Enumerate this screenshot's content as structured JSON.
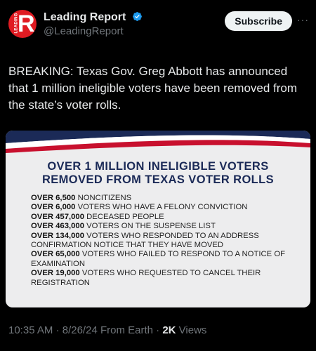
{
  "header": {
    "account_name": "Leading Report",
    "handle": "@LeadingReport",
    "avatar_letter": "R",
    "avatar_side_text": "LEADING",
    "subscribe_label": "Subscribe",
    "more_label": "···",
    "verified_icon": "verified-badge-icon",
    "brand_color": "#e01b22"
  },
  "tweet": {
    "text": "BREAKING: Texas Gov. Greg Abbott has announced that 1 million ineligible voters have been removed from the state’s voter rolls."
  },
  "card": {
    "title_line1": "OVER 1 MILLION INELIGIBLE VOTERS",
    "title_line2": "REMOVED FROM TEXAS VOTER ROLLS",
    "items": [
      {
        "amount": "OVER 6,500",
        "desc": " NONCITIZENS"
      },
      {
        "amount": "OVER 6,000",
        "desc": " VOTERS WHO HAVE A FELONY CONVICTION"
      },
      {
        "amount": "OVER 457,000",
        "desc": " DECEASED PEOPLE"
      },
      {
        "amount": "OVER 463,000",
        "desc": " VOTERS ON THE SUSPENSE LIST"
      },
      {
        "amount": "OVER 134,000",
        "desc": " VOTERS WHO RESPONDED TO AN ADDRESS CONFIRMATION NOTICE THAT THEY HAVE MOVED"
      },
      {
        "amount": "OVER 65,000",
        "desc": " VOTERS WHO FAILED TO RESPOND TO A NOTICE OF EXAMINATION"
      },
      {
        "amount": "OVER 19,000",
        "desc": " VOTERS WHO REQUESTED TO CANCEL THEIR REGISTRATION"
      }
    ],
    "colors": {
      "navy": "#1b2a57",
      "red": "#c8102e",
      "background": "#ededee"
    }
  },
  "footer": {
    "time": "10:35 AM",
    "date": "8/26/24",
    "source": "From Earth",
    "views_count": "2K",
    "views_label": "Views"
  }
}
